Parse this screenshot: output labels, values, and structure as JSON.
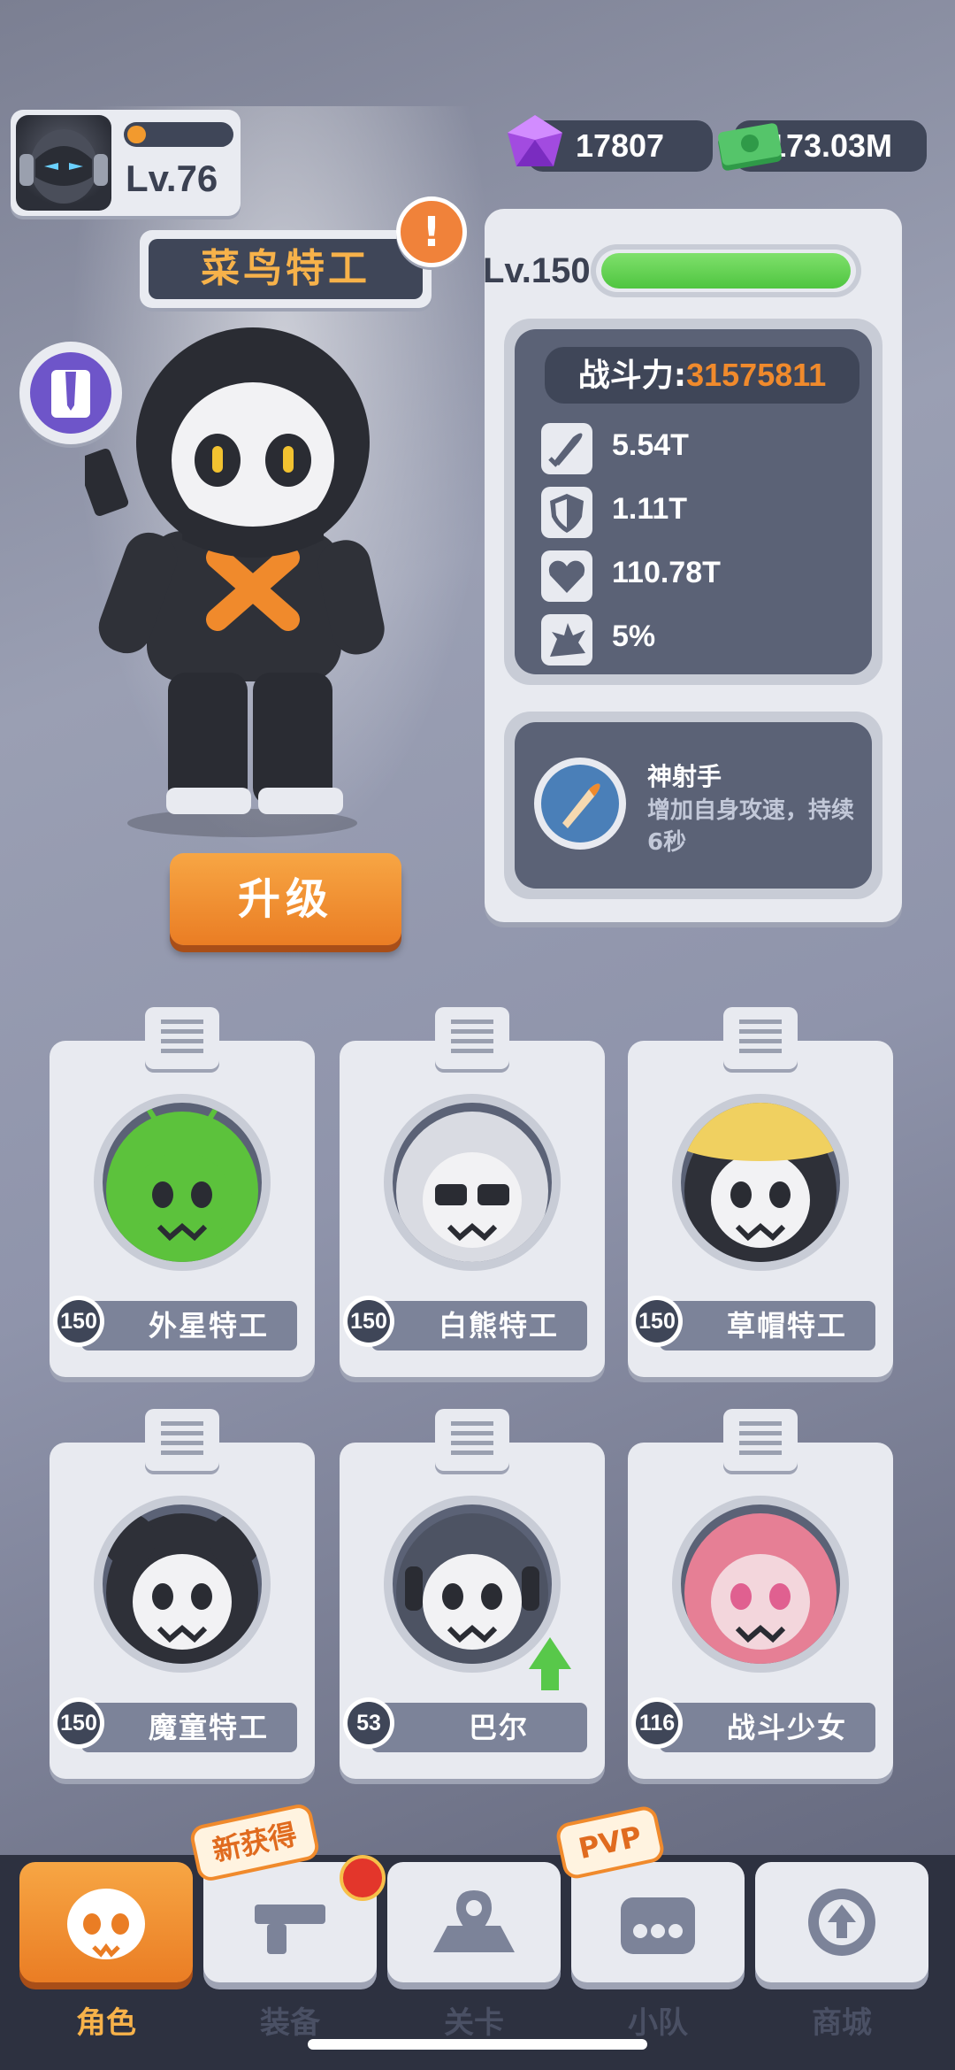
{
  "player": {
    "level": "Lv.76",
    "xp_fraction": 0.18
  },
  "currency": {
    "gems": "17807",
    "cash": "173.03M"
  },
  "hero": {
    "name": "菜鸟特工",
    "alert": "!",
    "upgrade_label": "升级",
    "level": "Lv.150",
    "hp_fraction": 1.0,
    "power_label": "战斗力:",
    "power_value": "31575811",
    "stats": [
      {
        "icon": "bullet-icon",
        "value": "5.54T"
      },
      {
        "icon": "shield-icon",
        "value": "1.11T"
      },
      {
        "icon": "heart-icon",
        "value": "110.78T"
      },
      {
        "icon": "crit-burst-icon",
        "value": "5%"
      }
    ],
    "skill": {
      "name": "神射手",
      "description": "增加自身攻速，持续6秒"
    }
  },
  "characters": [
    {
      "level": "150",
      "name": "外星特工",
      "color": "#5cc23c"
    },
    {
      "level": "150",
      "name": "白熊特工",
      "color": "#d9dbe2"
    },
    {
      "level": "150",
      "name": "草帽特工",
      "color": "#2e3038"
    },
    {
      "level": "150",
      "name": "魔童特工",
      "color": "#2e3038"
    },
    {
      "level": "53",
      "name": "巴尔",
      "color": "#4d5363"
    },
    {
      "level": "116",
      "name": "战斗少女",
      "color": "#e67f95"
    }
  ],
  "nav": {
    "items": [
      {
        "label": "角色",
        "active": true
      },
      {
        "label": "装备",
        "tag": "新获得"
      },
      {
        "label": "关卡"
      },
      {
        "label": "小队",
        "tag": "PVP"
      },
      {
        "label": "商城"
      }
    ]
  },
  "colors": {
    "accent": "#f08a2c",
    "panel": "#e8eaf0",
    "dark": "#3f4658",
    "hp": "#4fc540"
  }
}
